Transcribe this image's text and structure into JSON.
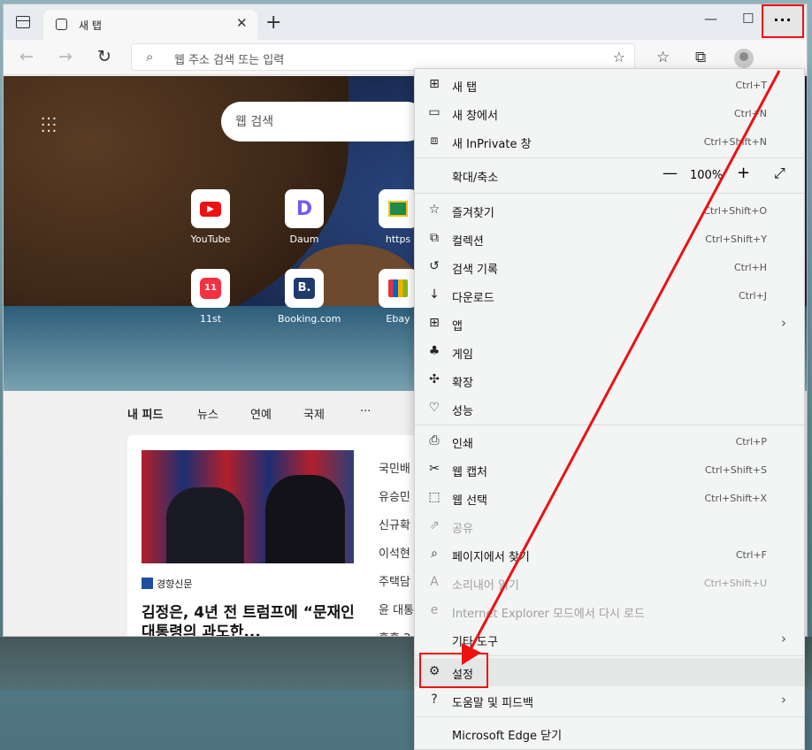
{
  "tab": {
    "title": "새 탭"
  },
  "address": {
    "placeholder": "웹 주소 검색 또는 입력"
  },
  "newtab": {
    "search_placeholder": "웹 검색",
    "tiles": [
      {
        "label": "YouTube"
      },
      {
        "label": "Daum"
      },
      {
        "label": "https"
      },
      {
        "label": "11st"
      },
      {
        "label": "Booking.com"
      },
      {
        "label": "Ebay"
      }
    ]
  },
  "feed": {
    "tabs": [
      "내 피드",
      "뉴스",
      "연예",
      "국제",
      "···"
    ],
    "source": "경향신문",
    "headline": "김정은, 4년 전 트럼프에 “문재인 대통령의 과도한...",
    "side_items": [
      "국민배",
      "유승민",
      "신규확",
      "이석현",
      "주택담",
      "윤 대통",
      "흥흥:2"
    ]
  },
  "menu": {
    "new_tab": {
      "label": "새 탭",
      "shortcut": "Ctrl+T"
    },
    "new_window": {
      "label": "새 창에서",
      "shortcut": "Ctrl+N"
    },
    "new_inprivate": {
      "label": "새 InPrivate 창",
      "shortcut": "Ctrl+Shift+N"
    },
    "zoom": {
      "label": "확대/축소",
      "minus": "—",
      "value": "100%",
      "plus": "+",
      "fullscreen": "⤢"
    },
    "favorites": {
      "label": "즐겨찾기",
      "shortcut": "Ctrl+Shift+O"
    },
    "collections": {
      "label": "컬렉션",
      "shortcut": "Ctrl+Shift+Y"
    },
    "history": {
      "label": "검색 기록",
      "shortcut": "Ctrl+H"
    },
    "downloads": {
      "label": "다운로드",
      "shortcut": "Ctrl+J"
    },
    "apps": {
      "label": "앱"
    },
    "games": {
      "label": "게임"
    },
    "extensions": {
      "label": "확장"
    },
    "performance": {
      "label": "성능"
    },
    "print": {
      "label": "인쇄",
      "shortcut": "Ctrl+P"
    },
    "web_capture": {
      "label": "웹 캡처",
      "shortcut": "Ctrl+Shift+S"
    },
    "web_select": {
      "label": "웹 선택",
      "shortcut": "Ctrl+Shift+X"
    },
    "share": {
      "label": "공유"
    },
    "find": {
      "label": "페이지에서 찾기",
      "shortcut": "Ctrl+F"
    },
    "read_aloud": {
      "label": "소리내어 읽기",
      "shortcut": "Ctrl+Shift+U"
    },
    "ie_mode": {
      "label": "Internet Explorer 모드에서 다시 로드"
    },
    "more_tools": {
      "label": "기타 도구"
    },
    "settings": {
      "label": "설정"
    },
    "help": {
      "label": "도움말 및 피드백"
    },
    "close": {
      "label": "Microsoft Edge 닫기"
    }
  }
}
